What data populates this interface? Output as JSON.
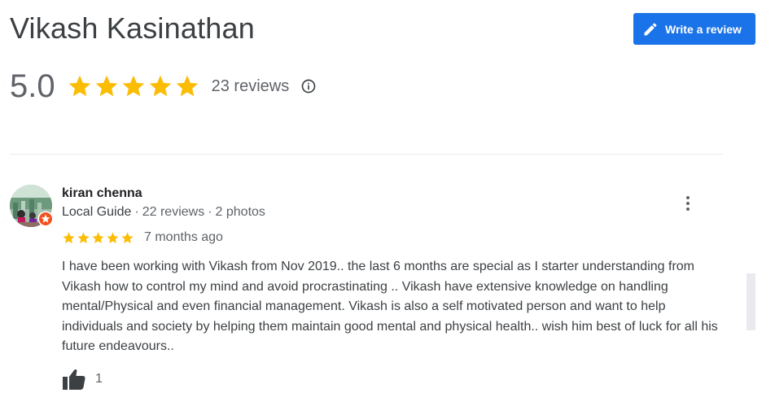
{
  "place": {
    "title": "Vikash Kasinathan"
  },
  "write_review": {
    "label": "Write a review",
    "icon": "pencil-icon"
  },
  "summary": {
    "rating": "5.0",
    "stars": 5,
    "reviews_count": "23 reviews",
    "info_icon": "info-icon",
    "star_color": "#fbbc04"
  },
  "review": {
    "name": "kiran chenna",
    "badge": "Local Guide",
    "separator": "·",
    "reviews": "22 reviews",
    "photos": "2 photos",
    "stars": 5,
    "time": "7 months ago",
    "text": "I have been working with Vikash from Nov 2019.. the last 6 months are special as I starter understanding from Vikash how to control my mind and avoid procrastinating .. Vikash have extensive knowledge on handling mental/Physical and even financial management. Vikash is also a self motivated person and want to help individuals and society by helping them maintain good mental and physical health.. wish him best of luck for all his future endeavours..",
    "likes": "1",
    "more_icon": "more-vert-icon",
    "like_icon": "thumbs-up-icon"
  },
  "colors": {
    "accent": "#1a73e8",
    "badge": "#f4511e"
  }
}
